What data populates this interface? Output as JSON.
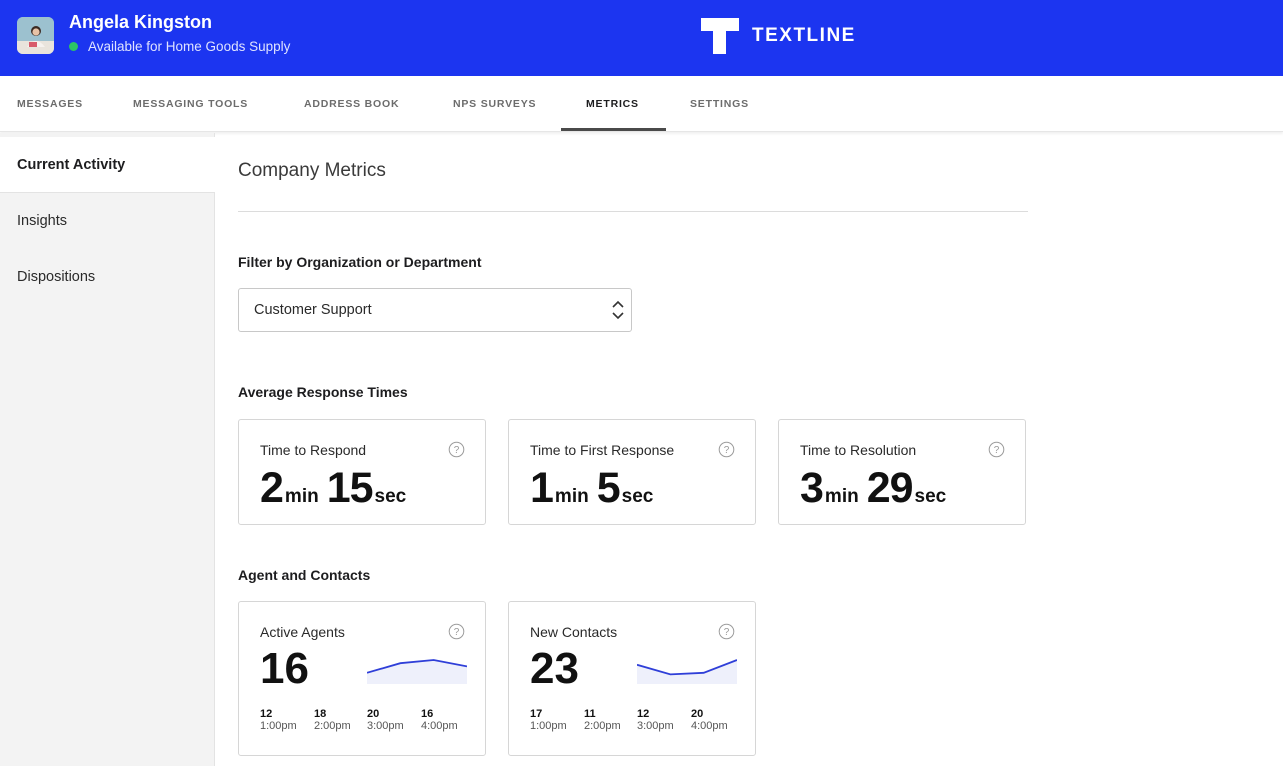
{
  "header": {
    "user_name": "Angela Kingston",
    "status_text": "Available for Home Goods Supply",
    "status_color": "#2cc466",
    "brand_name": "TEXTLINE",
    "brand_color": "#1c35f0"
  },
  "nav": {
    "tabs": [
      {
        "label": "MESSAGES",
        "active": false
      },
      {
        "label": "MESSAGING TOOLS",
        "active": false
      },
      {
        "label": "ADDRESS BOOK",
        "active": false
      },
      {
        "label": "NPS SURVEYS",
        "active": false
      },
      {
        "label": "METRICS",
        "active": true
      },
      {
        "label": "SETTINGS",
        "active": false
      }
    ]
  },
  "sidebar": {
    "items": [
      {
        "label": "Current Activity",
        "active": true
      },
      {
        "label": "Insights",
        "active": false
      },
      {
        "label": "Dispositions",
        "active": false
      }
    ]
  },
  "main": {
    "title": "Company Metrics",
    "filter_label": "Filter by Organization or Department",
    "filter_value": "Customer Support",
    "response_section_label": "Average Response Times",
    "response_cards": [
      {
        "label": "Time to Respond",
        "minutes": "2",
        "seconds": "15",
        "min_unit": "min",
        "sec_unit": "sec",
        "icon": "help-icon"
      },
      {
        "label": "Time to First Response",
        "minutes": "1",
        "seconds": "5",
        "min_unit": "min",
        "sec_unit": "sec",
        "icon": "help-icon"
      },
      {
        "label": "Time to Resolution",
        "minutes": "3",
        "seconds": "29",
        "min_unit": "min",
        "sec_unit": "sec",
        "icon": "help-icon"
      }
    ],
    "agents_section_label": "Agent and Contacts",
    "agent_cards": [
      {
        "label": "Active Agents",
        "value": "16",
        "icon": "help-icon",
        "series": [
          {
            "count": "12",
            "time": "1:00pm"
          },
          {
            "count": "18",
            "time": "2:00pm"
          },
          {
            "count": "20",
            "time": "3:00pm"
          },
          {
            "count": "16",
            "time": "4:00pm"
          }
        ]
      },
      {
        "label": "New Contacts",
        "value": "23",
        "icon": "help-icon",
        "series": [
          {
            "count": "17",
            "time": "1:00pm"
          },
          {
            "count": "11",
            "time": "2:00pm"
          },
          {
            "count": "12",
            "time": "3:00pm"
          },
          {
            "count": "20",
            "time": "4:00pm"
          }
        ]
      }
    ],
    "sparkline_color": "#2f3fd8"
  }
}
